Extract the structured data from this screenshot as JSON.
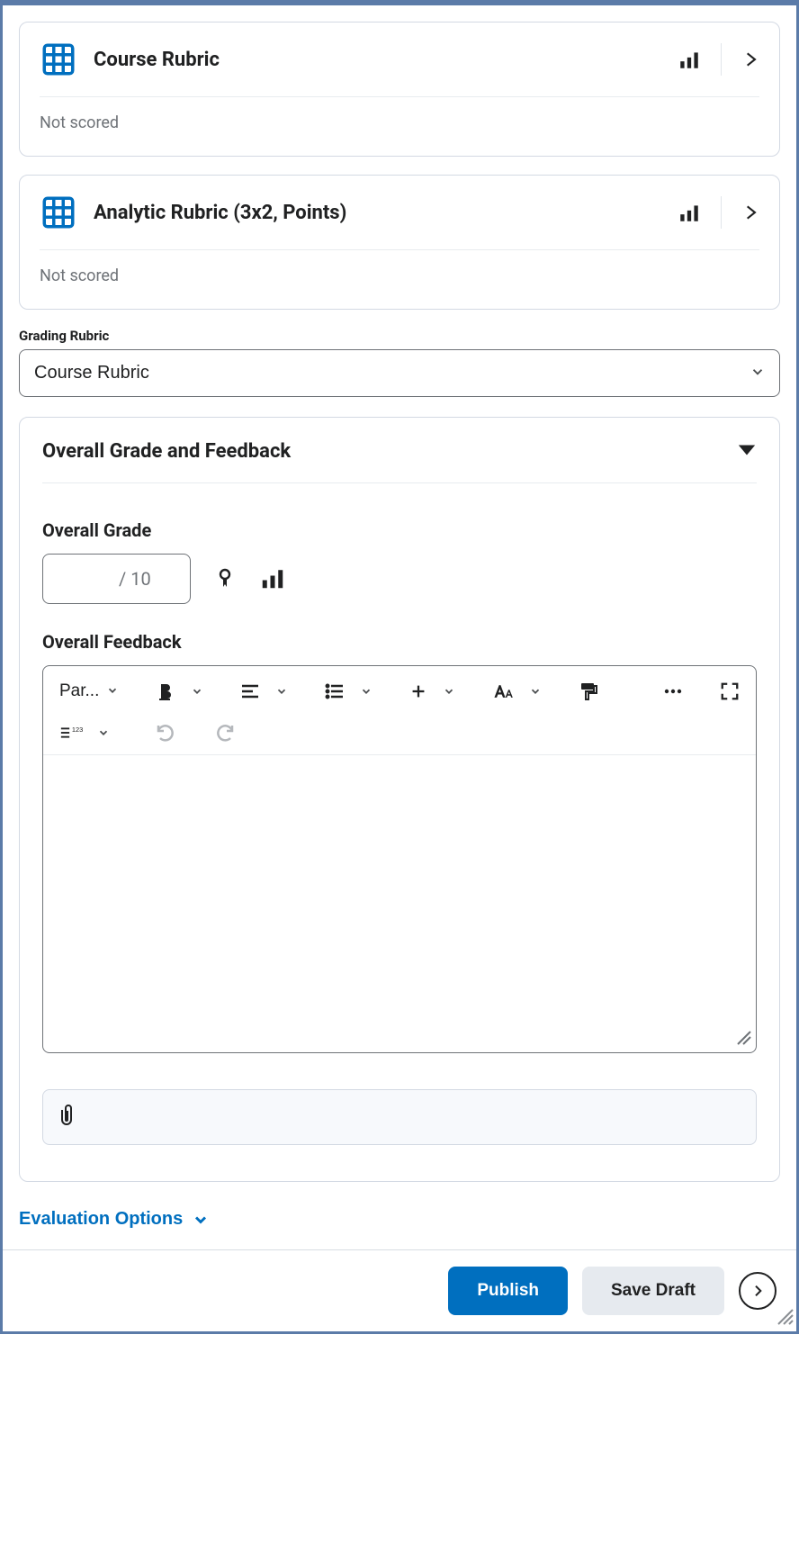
{
  "rubrics": [
    {
      "title": "Course Rubric",
      "status": "Not scored"
    },
    {
      "title": "Analytic Rubric (3x2, Points)",
      "status": "Not scored"
    }
  ],
  "grading_rubric": {
    "label": "Grading Rubric",
    "selected": "Course Rubric"
  },
  "panel": {
    "title": "Overall Grade and Feedback",
    "grade": {
      "label": "Overall Grade",
      "value": "",
      "denom": "/ 10"
    },
    "feedback": {
      "label": "Overall Feedback",
      "format_label": "Par..."
    }
  },
  "eval_options_label": "Evaluation Options",
  "footer": {
    "publish": "Publish",
    "save_draft": "Save Draft"
  }
}
